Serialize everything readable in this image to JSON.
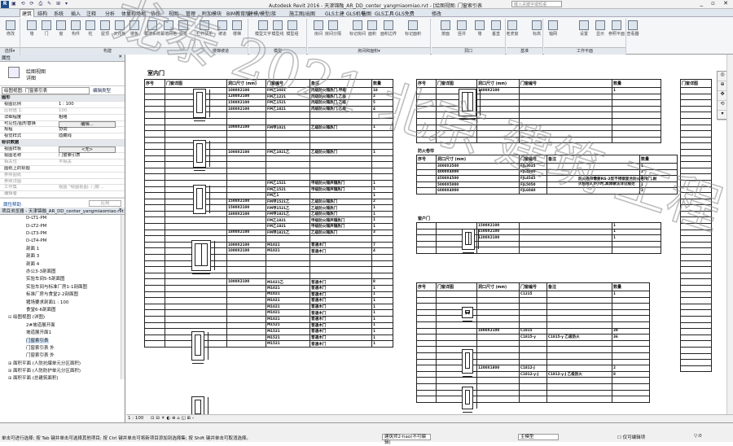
{
  "window": {
    "title": "Autodesk Revit 2016 -   天津锦融_AR_DD_center_yangmiaomiao.rvt - [绘图视图: 门窗索引表",
    "search_placeholder": "键入关键字或短语",
    "controls": "_ ▫ ✕"
  },
  "quick_access": "▣ ⟲ ⟳ ⎙ ✎ ⊞ ▾",
  "app_button": "R",
  "ribbon_tabs": [
    "建筑",
    "结构",
    "系统",
    "插入",
    "注释",
    "分析",
    "体量和场地",
    "协作",
    "视图",
    "管理",
    "附加模块",
    "BIM教育版",
    "建模/模型/族",
    "施工图/出图",
    "GLS土建",
    "GLS机电",
    "快图",
    "GLS工具",
    "GLS免费",
    "修改"
  ],
  "ribbon": {
    "buttons": [
      "修改",
      "墙",
      "门",
      "窗",
      "构件",
      "柱",
      "屋顶",
      "天花板",
      "楼板",
      "幕墙系统",
      "幕墙网格",
      "竖梃",
      "栏杆扶手",
      "坡道",
      "楼梯",
      "模型文字",
      "模型线",
      "模型组",
      "房间",
      "房间分隔",
      "标记房间",
      "面积",
      "面积边界",
      "标记面积",
      "按面",
      "竖井",
      "墙",
      "垂直",
      "老虎窗",
      "标高",
      "轴网",
      "设置",
      "显示",
      "参照平面",
      "查看器"
    ],
    "groups": [
      "选择▾",
      "构建",
      "楼梯坡道",
      "模型",
      "房间和面积▾",
      "洞口",
      "基准",
      "工作平面"
    ]
  },
  "properties": {
    "header": "属性",
    "type_icon": "drafting-view-icon",
    "type_line1": "绘图视图",
    "type_line2": "详图",
    "instance_dropdown": "绘图视图: 门窗索引表",
    "edit_type": "编辑类型",
    "rows": [
      {
        "k": "图形",
        "v": "",
        "cat": true
      },
      {
        "k": "视图比例",
        "v": "1 : 100"
      },
      {
        "k": "比例值 1:",
        "v": "100",
        "dim": true
      },
      {
        "k": "详细程度",
        "v": "粗略"
      },
      {
        "k": "可见性/图形替换",
        "v": "编辑...",
        "btn": true
      },
      {
        "k": "规程",
        "v": "协调"
      },
      {
        "k": "视觉样式",
        "v": "隐藏线"
      },
      {
        "k": "标识数据",
        "v": "",
        "cat": true
      },
      {
        "k": "视图样板",
        "v": "<无>",
        "btn": true
      },
      {
        "k": "视图名称",
        "v": "门窗索引表"
      },
      {
        "k": "相关性",
        "v": "不相关",
        "dim": true
      },
      {
        "k": "图纸上的标题",
        "v": ""
      },
      {
        "k": "参照图纸",
        "v": "",
        "dim": true
      },
      {
        "k": "参照详图",
        "v": "",
        "dim": true
      },
      {
        "k": "工作集",
        "v": "视图 \"绘图视图: 门窗...",
        "dim": true
      },
      {
        "k": "编辑者",
        "v": "",
        "dim": true
      }
    ],
    "help": "属性帮助",
    "apply": "应用"
  },
  "browser": {
    "header": "项目浏览器 - 天津锦融_AR_DD_center_yangmiaomiao.rvt",
    "items": [
      {
        "t": "D-LT1-PM",
        "lvl": 3
      },
      {
        "t": "D-LT2-PM",
        "lvl": 3
      },
      {
        "t": "D-LT3-PM",
        "lvl": 3
      },
      {
        "t": "D-LT4-PM",
        "lvl": 3
      },
      {
        "t": "剖面 1",
        "lvl": 3
      },
      {
        "t": "剖面 3",
        "lvl": 3
      },
      {
        "t": "剖面 4",
        "lvl": 3
      },
      {
        "t": "办公3-3剖面图",
        "lvl": 3
      },
      {
        "t": "实验车间5-5剖面图",
        "lvl": 3
      },
      {
        "t": "实验车间与标准厂房1-1剖面图",
        "lvl": 3
      },
      {
        "t": "标准厂房与食堂2-2剖面图",
        "lvl": 3
      },
      {
        "t": "猪场要求剖面1 : 100",
        "lvl": 3
      },
      {
        "t": "食堂6-6剖面图",
        "lvl": 3
      },
      {
        "t": "绘图视图 (详图)",
        "lvl": 2,
        "tg": "⊟"
      },
      {
        "t": "2#坡道展开面",
        "lvl": 3
      },
      {
        "t": "坡道展开面1",
        "lvl": 3
      },
      {
        "t": "门窗索引表",
        "lvl": 3,
        "sel": true
      },
      {
        "t": "门窗索引表 外",
        "lvl": 3
      },
      {
        "t": "门窗索引表 外",
        "lvl": 3
      },
      {
        "t": "面积平面 (人防抗爆单元分区面积)",
        "lvl": 2,
        "tg": "⊞"
      },
      {
        "t": "面积平面 (人防防护单元分区面积)",
        "lvl": 2,
        "tg": "⊞"
      },
      {
        "t": "面积平面 (总建筑面积)",
        "lvl": 2,
        "tg": "⊞"
      }
    ]
  },
  "schedule": {
    "title": "室内门",
    "headers": [
      "序号",
      "门窗详图",
      "洞口尺寸 (mm)",
      "门窗编号",
      "备注",
      "数量"
    ],
    "left_rows": [
      [
        "",
        "",
        "1000X2100",
        "FM乙1021",
        "丙级防火隔热门,甲级",
        "18"
      ],
      [
        "",
        "",
        "1200X2100",
        "FM乙1221",
        "丙级防火隔热门,乙级",
        "2"
      ],
      [
        "",
        "",
        "1500X2100",
        "FM乙1521",
        "丙级防火隔热门,乙级",
        "5"
      ],
      [
        "",
        "",
        "1800X2100",
        "FM乙1821",
        "丙级防火隔热门,乙级",
        "4"
      ],
      [
        "",
        "",
        "",
        "",
        "",
        ""
      ],
      [
        "",
        "",
        "",
        "",
        "",
        ""
      ],
      [
        "",
        "",
        "1000X2100",
        "FM甲1021",
        "乙级防火隔热门",
        "1"
      ],
      [
        "",
        "",
        "",
        "",
        "",
        ""
      ],
      [
        "",
        "",
        "",
        "",
        "",
        ""
      ],
      [
        "",
        "",
        "",
        "",
        "",
        ""
      ],
      [
        "",
        "",
        "1000X2100",
        "FM乙1021乙",
        "乙级防火隔热门",
        "1"
      ],
      [
        "",
        "",
        "",
        "",
        "",
        ""
      ],
      [
        "",
        "",
        "",
        "",
        "",
        ""
      ],
      [
        "",
        "",
        "",
        "",
        "",
        ""
      ],
      [
        "",
        "",
        "",
        "",
        "",
        ""
      ],
      [
        "",
        "",
        "",
        "FM乙1521",
        "甲级防火隔声隔热门",
        "1"
      ],
      [
        "",
        "",
        "",
        "FM乙1521",
        "甲级防火隔声隔热门",
        "1"
      ],
      [
        "",
        "",
        "",
        "FM乙1",
        "",
        "1"
      ],
      [
        "",
        "",
        "1500X2100",
        "FM甲1521乙",
        "乙级防火隔热门",
        "2"
      ],
      [
        "",
        "",
        "1500X2100",
        "FM甲1521乙",
        "乙级防火隔热门",
        "1"
      ],
      [
        "",
        "",
        "1800X2100",
        "FM甲1821乙",
        "乙级防火隔热门",
        "1"
      ],
      [
        "",
        "",
        "",
        "FM乙1821",
        "甲级防火隔声隔热门",
        "1"
      ],
      [
        "",
        "",
        "",
        "FM乙1821",
        "甲级防火隔声隔热门",
        "1"
      ],
      [
        "",
        "",
        "1800X2100",
        "FM甲1821乙",
        "乙级防火隔热门",
        "3"
      ],
      [
        "",
        "",
        "",
        "",
        "",
        ""
      ],
      [
        "",
        "",
        "1000X2100",
        "M1021",
        "普通木门",
        "7"
      ],
      [
        "",
        "",
        "1000X2100",
        "M1021",
        "普通木门",
        "4"
      ],
      [
        "",
        "",
        "",
        "",
        "",
        ""
      ],
      [
        "",
        "",
        "",
        "",
        "",
        ""
      ],
      [
        "",
        "",
        "",
        "",
        "",
        ""
      ],
      [
        "",
        "",
        "",
        "",
        "",
        ""
      ],
      [
        "",
        "",
        "1000X2100",
        "M1021乙",
        "普通木门",
        "8"
      ],
      [
        "",
        "",
        "",
        "M1021",
        "普通木门",
        "1"
      ],
      [
        "",
        "",
        "",
        "M1021",
        "普通木门",
        "1"
      ],
      [
        "",
        "",
        "",
        "M1021",
        "普通木门",
        "1"
      ],
      [
        "",
        "",
        "",
        "M1021",
        "普通木门",
        "1"
      ],
      [
        "",
        "",
        "",
        "M1021",
        "普通木门",
        "1"
      ],
      [
        "",
        "",
        "",
        "M1021",
        "普通木门",
        "1"
      ],
      [
        "",
        "",
        "",
        "M1521",
        "普通木门",
        "1"
      ],
      [
        "",
        "",
        "",
        "M1521",
        "普通木门",
        "1"
      ],
      [
        "",
        "",
        "",
        "M1521",
        "普通木门",
        "1"
      ],
      [
        "",
        "",
        "",
        "M1521",
        "普通木门",
        "1"
      ]
    ],
    "mid_top_headers": [
      "序号",
      "门窗详图",
      "洞口尺寸 (mm)",
      "门窗编号",
      "数量"
    ],
    "mid_top_rows": [
      [
        "",
        "",
        "1800X2100",
        "",
        "1"
      ],
      [
        "",
        "",
        "",
        "",
        ""
      ],
      [
        "",
        "",
        "",
        "",
        ""
      ],
      [
        "",
        "",
        "",
        "",
        ""
      ],
      [
        "",
        "",
        "",
        "",
        ""
      ],
      [
        "",
        "",
        "",
        "",
        ""
      ],
      [
        "",
        "",
        "",
        "",
        ""
      ],
      [
        "",
        "",
        "",
        "",
        ""
      ],
      [
        "",
        "",
        "",
        "",
        ""
      ]
    ],
    "sec2_label": "防火卷帘",
    "sec2_headers": [
      "序号",
      "洞口尺寸 (mm)",
      "门窗编号",
      "备注",
      "数量"
    ],
    "sec2_rows": [
      [
        "",
        "3000X3500",
        "FJL3035",
        "",
        "1"
      ],
      [
        "",
        "4000X4000",
        "FJL4040",
        "",
        "2"
      ],
      [
        "",
        "4500X4500",
        "FJL4545",
        "",
        "1"
      ],
      [
        "",
        "5000X5000",
        "FJL5050",
        "",
        "1"
      ],
      [
        "",
        "6000X4000",
        "FJL6040",
        "",
        "2"
      ]
    ],
    "sec2_note": "防火卷帘需要RS-2型不锈钢复合防火卷帘门,耐火极限3.0小时,具体做法详见规范",
    "sec3_label": "窗户门",
    "sec3_rows": [
      [
        "",
        "",
        "1500X2100",
        "",
        "1"
      ],
      [
        "",
        "",
        "1500X2100",
        "",
        "1"
      ],
      [
        "",
        "",
        "1200X2100",
        "",
        "1"
      ],
      [
        "",
        "",
        "",
        "",
        ""
      ],
      [
        "",
        "",
        "",
        "",
        ""
      ]
    ],
    "sec4_headers": [
      "序号",
      "门窗详图",
      "洞口尺寸 (mm)",
      "门窗编号",
      "备注",
      "数量"
    ],
    "sec4_rows": [
      [
        "",
        "",
        "",
        "C1215",
        "",
        "1"
      ],
      [
        "",
        "",
        "",
        "",
        "",
        ""
      ],
      [
        "",
        "",
        "",
        "",
        "",
        ""
      ],
      [
        "",
        "",
        "",
        "",
        "",
        ""
      ],
      [
        "",
        "",
        "",
        "",
        "",
        ""
      ],
      [
        "",
        "",
        "",
        "",
        "",
        ""
      ],
      [
        "",
        "",
        "1800X2100",
        "C1815",
        "",
        "39"
      ],
      [
        "",
        "",
        "",
        "C1815-y",
        "C1815-y 乙级防火",
        "36"
      ],
      [
        "",
        "",
        "",
        "",
        "",
        ""
      ],
      [
        "",
        "",
        "",
        "",
        "",
        ""
      ],
      [
        "",
        "",
        "",
        "",
        "",
        ""
      ],
      [
        "",
        "",
        "",
        "",
        "",
        ""
      ],
      [
        "",
        "",
        "1200X1800",
        "C1812-J",
        "",
        "2"
      ],
      [
        "",
        "",
        "",
        "C1812-y-J",
        "C1812-y-J 乙级防火",
        "8"
      ],
      [
        "",
        "",
        "",
        "",
        "",
        ""
      ],
      [
        "",
        "",
        "",
        "",
        "",
        ""
      ],
      [
        "",
        "",
        "",
        "",
        "",
        ""
      ],
      [
        "",
        "",
        "",
        "",
        "",
        ""
      ]
    ],
    "far_header": "门窗详图"
  },
  "view_control": {
    "scale": "1 : 100",
    "icons": "⊡ ⊟ ☀ ◐ ⊕ ⌂ ◱ ⊞ ‹"
  },
  "statusbar": {
    "hint": "单击可进行选择; 按 Tab 键并单击可选择其他项目; 按 Ctrl 键并单击可将新项目添加到选择集; 按 Shift 键并单击可取消选择。",
    "workset": "建筑师2-hao(不可编辑)",
    "model": "主模型",
    "editable": "☐ 仅可编辑项",
    "selected": "▽:0"
  },
  "watermark": "龙泰 2021 北京 建筑 工程 勘察 设计"
}
